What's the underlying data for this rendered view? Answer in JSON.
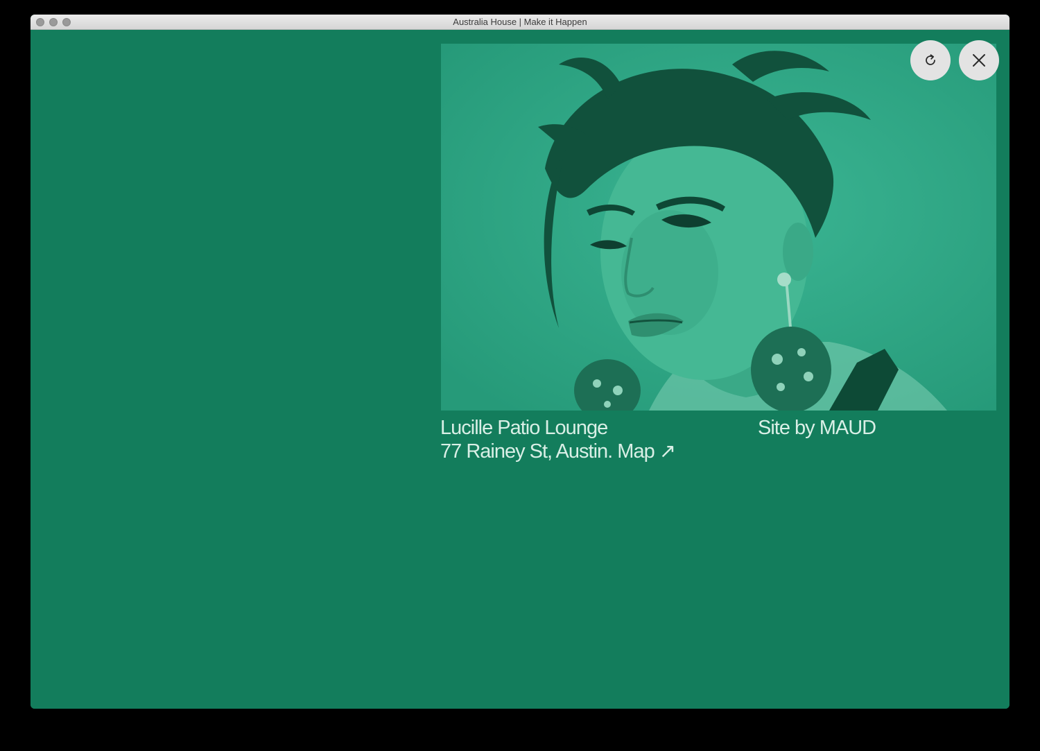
{
  "window": {
    "title": "Australia House | Make it Happen"
  },
  "colors": {
    "background": "#137d5c",
    "photo_tint": "#2aa07f",
    "text": "#d9efe6",
    "button_bg": "#e3e3e3"
  },
  "controls": {
    "reload_icon": "reload-icon",
    "close_icon": "close-icon"
  },
  "caption": {
    "venue": "Lucille Patio Lounge",
    "address": "77 Rainey St, Austin.",
    "map_label": "Map",
    "map_arrow": "↗",
    "credit": "Site by MAUD"
  }
}
